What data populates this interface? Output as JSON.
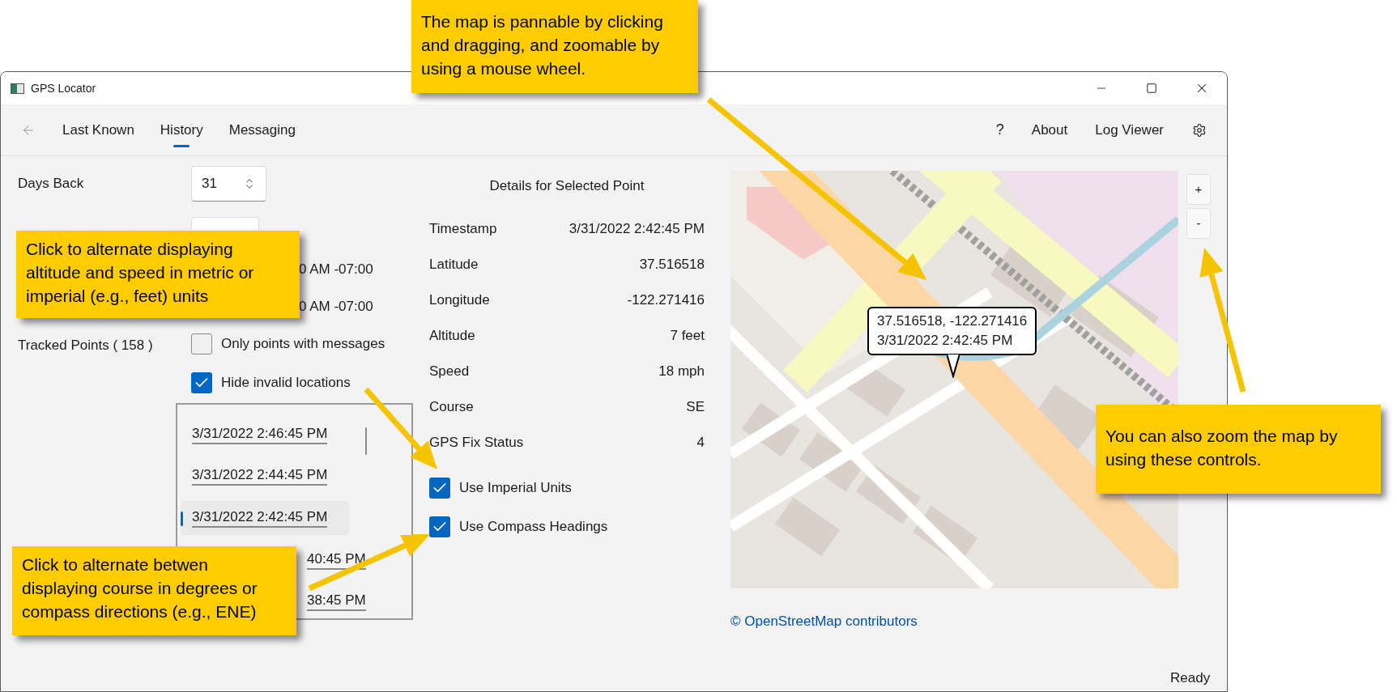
{
  "window": {
    "title": "GPS Locator"
  },
  "nav": {
    "tabs": [
      {
        "label": "Last Known",
        "selected": false
      },
      {
        "label": "History",
        "selected": true
      },
      {
        "label": "Messaging",
        "selected": false
      }
    ],
    "help": "?",
    "links": [
      "About",
      "Log Viewer"
    ]
  },
  "history": {
    "days_back": {
      "label": "Days Back",
      "value": "31"
    },
    "date_fragments": [
      "0 AM -07:00",
      "0 AM -07:00"
    ],
    "tracked_points": "Tracked Points ( 158 )",
    "filters": [
      {
        "label": "Only points with messages",
        "checked": false
      },
      {
        "label": "Hide invalid locations",
        "checked": true
      }
    ],
    "points": [
      {
        "label": "3/31/2022 2:46:45 PM",
        "selected": false,
        "kind": "full"
      },
      {
        "label": "3/31/2022 2:44:45 PM",
        "selected": false,
        "kind": "full"
      },
      {
        "label": "3/31/2022 2:42:45 PM",
        "selected": true,
        "kind": "full"
      },
      {
        "label": "40:45 PM",
        "selected": false,
        "kind": "clipped"
      },
      {
        "label": "38:45 PM",
        "selected": false,
        "kind": "clipped"
      }
    ]
  },
  "details": {
    "title": "Details for Selected Point",
    "rows": [
      {
        "label": "Timestamp",
        "value": "3/31/2022 2:42:45 PM"
      },
      {
        "label": "Latitude",
        "value": "37.516518"
      },
      {
        "label": "Longitude",
        "value": "-122.271416"
      },
      {
        "label": "Altitude",
        "value": "7 feet"
      },
      {
        "label": "Speed",
        "value": "18 mph"
      },
      {
        "label": "Course",
        "value": "SE"
      },
      {
        "label": "GPS Fix Status",
        "value": "4"
      }
    ],
    "options": [
      {
        "label": "Use Imperial Units",
        "checked": true
      },
      {
        "label": "Use Compass Headings",
        "checked": true
      }
    ]
  },
  "map": {
    "tooltip": [
      "37.516518, -122.271416",
      "3/31/2022 2:42:45 PM"
    ],
    "zoom_controls": [
      "+",
      "-"
    ],
    "attribution": "© OpenStreetMap contributors"
  },
  "status_bar": "Ready",
  "callouts": [
    {
      "text": "The map is pannable by clicking and dragging, and zoomable by using a mouse wheel."
    },
    {
      "text": "Click to alternate displaying altitude and speed in metric or imperial (e.g., feet) units"
    },
    {
      "text": "Click to alternate betwen displaying course in degrees or compass directions (e.g., ENE)"
    },
    {
      "text": "You can also zoom the map by using these controls."
    }
  ]
}
